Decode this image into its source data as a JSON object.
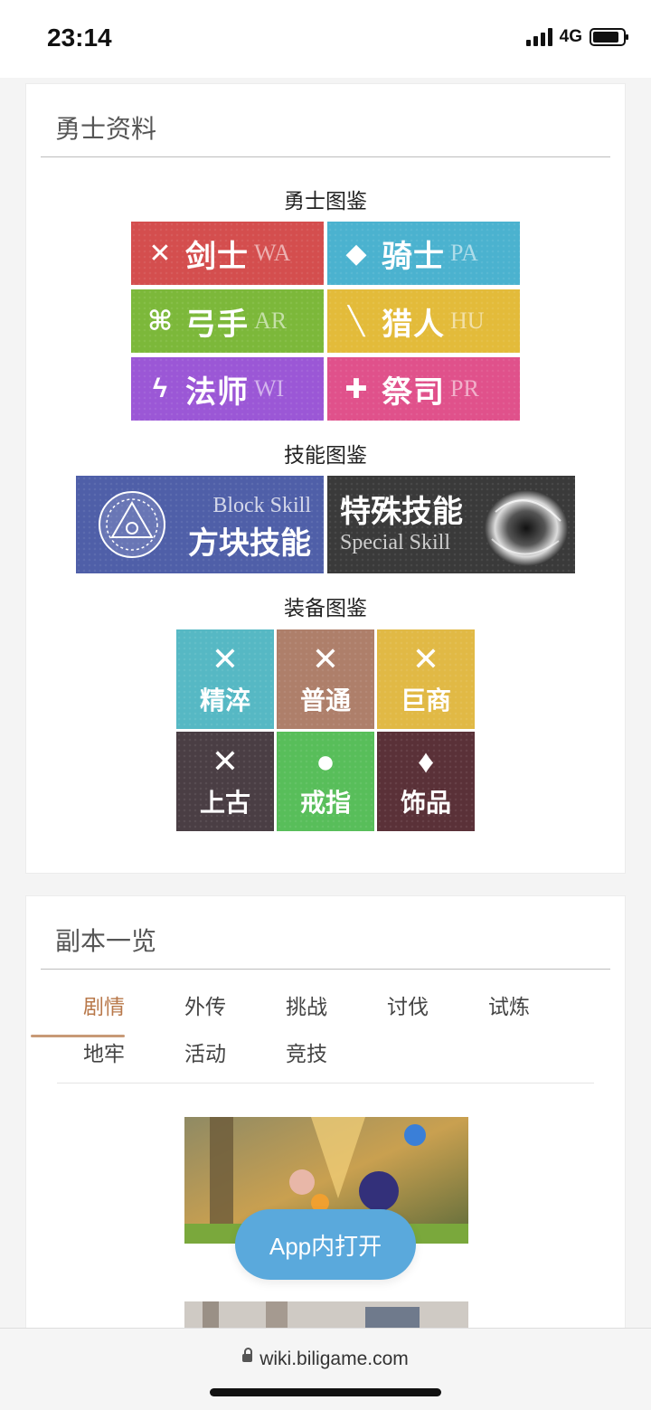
{
  "status": {
    "time": "23:14",
    "network": "4G"
  },
  "hero_section": {
    "title": "勇士资料",
    "heroes_label": "勇士图鉴",
    "heroes": [
      {
        "name": "剑士",
        "code": "WA",
        "color": "#d44e4e",
        "icon": "sword-icon",
        "glyph": "✕"
      },
      {
        "name": "骑士",
        "code": "PA",
        "color": "#4bb2cf",
        "icon": "shield-icon",
        "glyph": "◆"
      },
      {
        "name": "弓手",
        "code": "AR",
        "color": "#7cb83a",
        "icon": "bow-icon",
        "glyph": "⌘"
      },
      {
        "name": "猎人",
        "code": "HU",
        "color": "#e3bb3a",
        "icon": "spear-icon",
        "glyph": "╲"
      },
      {
        "name": "法师",
        "code": "WI",
        "color": "#9b57d6",
        "icon": "staff-icon",
        "glyph": "ϟ"
      },
      {
        "name": "祭司",
        "code": "PR",
        "color": "#e0518b",
        "icon": "cross-icon",
        "glyph": "✚"
      }
    ],
    "skills_label": "技能图鉴",
    "skills": [
      {
        "en": "Block Skill",
        "cn": "方块技能",
        "color": "#4f5fa8"
      },
      {
        "cn": "特殊技能",
        "en": "Special Skill",
        "color": "#3a3a3a"
      }
    ],
    "equip_label": "装备图鉴",
    "equipment": [
      {
        "name": "精淬",
        "color": "#56b8c4",
        "icon": "sword-icon",
        "glyph": "✕"
      },
      {
        "name": "普通",
        "color": "#ae7f6a",
        "icon": "sword-icon",
        "glyph": "✕"
      },
      {
        "name": "巨商",
        "color": "#e1b945",
        "icon": "sword-icon",
        "glyph": "✕"
      },
      {
        "name": "上古",
        "color": "#4a3e44",
        "icon": "sword-icon",
        "glyph": "✕"
      },
      {
        "name": "戒指",
        "color": "#58be5a",
        "icon": "ring-icon",
        "glyph": "●"
      },
      {
        "name": "饰品",
        "color": "#5a3138",
        "icon": "amulet-icon",
        "glyph": "♦"
      }
    ]
  },
  "dungeon_section": {
    "title": "副本一览",
    "tabs": [
      "剧情",
      "外传",
      "挑战",
      "讨伐",
      "试炼",
      "地牢",
      "活动",
      "竞技"
    ],
    "active_tab": "剧情"
  },
  "open_app_label": "App内打开",
  "browser": {
    "url": "wiki.biligame.com"
  }
}
